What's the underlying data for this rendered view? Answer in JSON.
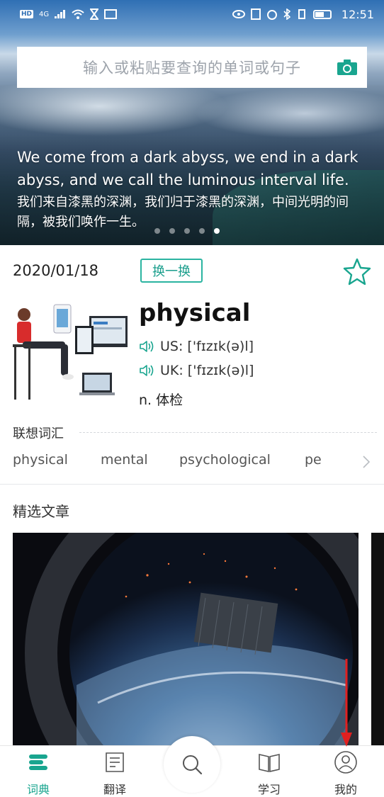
{
  "status_bar": {
    "network": "4G",
    "carrier_badge": "HD",
    "time": "12:51"
  },
  "search": {
    "placeholder": "输入或粘贴要查询的单词或句子"
  },
  "quote": {
    "en": "We come from a dark abyss, we end in a dark abyss, and we call the luminous interval life.",
    "zh": "我们来自漆黑的深渊，我们归于漆黑的深渊，中间光明的间隔，被我们唤作一生。",
    "slide_count": 5,
    "active_slide": 5
  },
  "word_card": {
    "date": "2020/01/18",
    "swap_label": "换一换",
    "word": "physical",
    "us_pron": "US: ['fɪzɪk(ə)l]",
    "uk_pron": "UK: ['fɪzɪk(ə)l]",
    "meaning": "n. 体检",
    "favorite_icon": "star-outline-icon"
  },
  "associations": {
    "title": "联想词汇",
    "words": [
      "physical",
      "mental",
      "psychological",
      "pe"
    ]
  },
  "articles": {
    "title": "精选文章"
  },
  "bottom_nav": {
    "items": [
      {
        "label": "词典",
        "icon": "dictionary-icon",
        "active": true
      },
      {
        "label": "翻译",
        "icon": "translate-icon",
        "active": false
      },
      {
        "label": "",
        "icon": "search-icon",
        "active": false
      },
      {
        "label": "学习",
        "icon": "book-icon",
        "active": false
      },
      {
        "label": "我的",
        "icon": "profile-icon",
        "active": false
      }
    ]
  },
  "colors": {
    "accent": "#19a58f",
    "annotation_arrow": "#e02020"
  }
}
